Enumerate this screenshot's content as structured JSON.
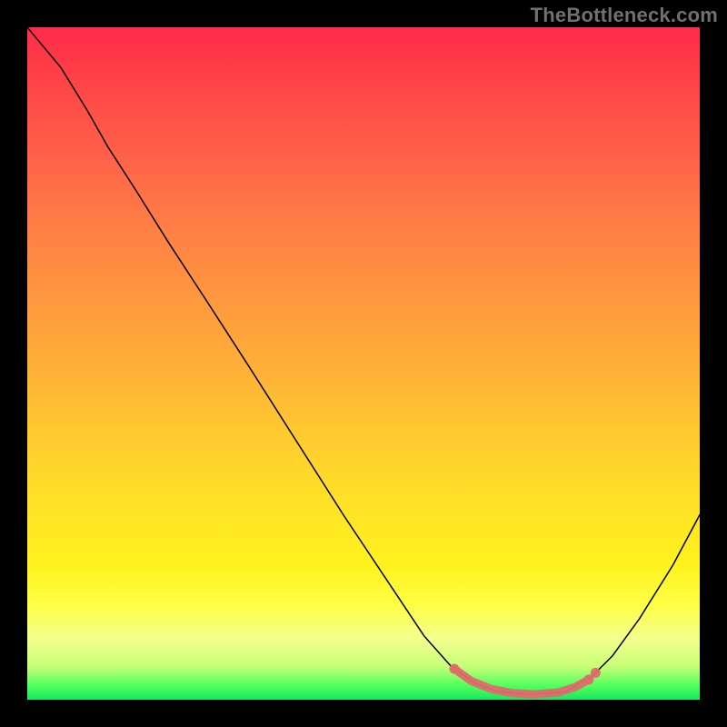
{
  "attribution": "TheBottleneck.com",
  "colors": {
    "marker": "#e06c6c",
    "curve": "#000000"
  },
  "chart_data": {
    "type": "line",
    "title": "",
    "xlabel": "",
    "ylabel": "",
    "xlim": [
      0,
      1
    ],
    "ylim": [
      0,
      1
    ],
    "grid": false,
    "curve": [
      {
        "x": 0.0,
        "y": 1.0
      },
      {
        "x": 0.05,
        "y": 0.94
      },
      {
        "x": 0.09,
        "y": 0.875
      },
      {
        "x": 0.12,
        "y": 0.822
      },
      {
        "x": 0.16,
        "y": 0.76
      },
      {
        "x": 0.21,
        "y": 0.68
      },
      {
        "x": 0.27,
        "y": 0.588
      },
      {
        "x": 0.33,
        "y": 0.495
      },
      {
        "x": 0.4,
        "y": 0.385
      },
      {
        "x": 0.47,
        "y": 0.275
      },
      {
        "x": 0.54,
        "y": 0.17
      },
      {
        "x": 0.59,
        "y": 0.095
      },
      {
        "x": 0.63,
        "y": 0.05
      },
      {
        "x": 0.665,
        "y": 0.025
      },
      {
        "x": 0.7,
        "y": 0.012
      },
      {
        "x": 0.75,
        "y": 0.008
      },
      {
        "x": 0.8,
        "y": 0.012
      },
      {
        "x": 0.84,
        "y": 0.035
      },
      {
        "x": 0.87,
        "y": 0.065
      },
      {
        "x": 0.91,
        "y": 0.12
      },
      {
        "x": 0.96,
        "y": 0.2
      },
      {
        "x": 1.0,
        "y": 0.275
      }
    ],
    "marker_region": [
      {
        "x": 0.635,
        "y": 0.046
      },
      {
        "x": 0.66,
        "y": 0.028
      },
      {
        "x": 0.69,
        "y": 0.016
      },
      {
        "x": 0.72,
        "y": 0.01
      },
      {
        "x": 0.755,
        "y": 0.008
      },
      {
        "x": 0.79,
        "y": 0.011
      },
      {
        "x": 0.815,
        "y": 0.019
      },
      {
        "x": 0.835,
        "y": 0.03
      }
    ],
    "marker_end_dots": [
      {
        "x": 0.635,
        "y": 0.046
      },
      {
        "x": 0.835,
        "y": 0.03
      },
      {
        "x": 0.845,
        "y": 0.04
      }
    ]
  }
}
